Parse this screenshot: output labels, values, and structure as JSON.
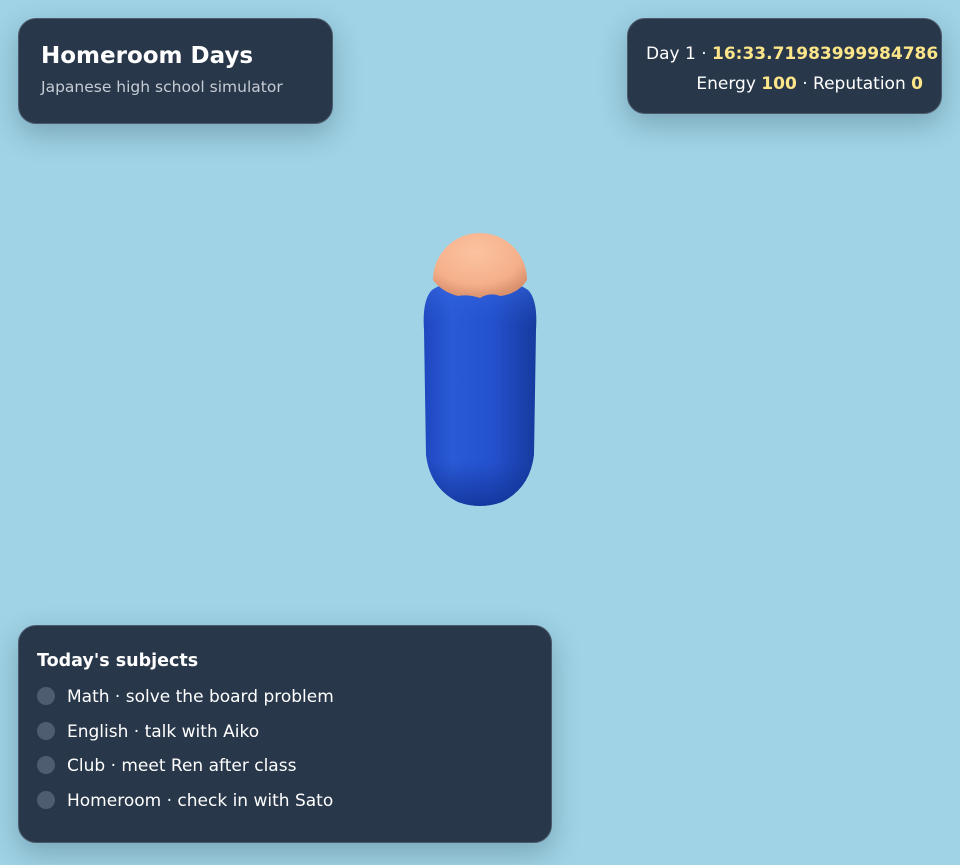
{
  "header": {
    "title": "Homeroom Days",
    "subtitle": "Japanese high school simulator"
  },
  "status": {
    "day_label": "Day 1",
    "separator": " · ",
    "time": "16:33.71983999984786",
    "energy_label": "Energy",
    "energy_value": "100",
    "reputation_label": "Reputation",
    "reputation_value": "0"
  },
  "subjects": {
    "heading": "Today's subjects",
    "items": [
      {
        "label": "Math · solve the board problem",
        "done": false
      },
      {
        "label": "English · talk with Aiko",
        "done": false
      },
      {
        "label": "Club · meet Ren after class",
        "done": false
      },
      {
        "label": "Homeroom · check in with Sato",
        "done": false
      }
    ]
  },
  "colors": {
    "sky": "#9fd3e5",
    "panel": "#283749",
    "accent": "#fde68a",
    "body": "#2556d6",
    "skin": "#f7b58e"
  }
}
